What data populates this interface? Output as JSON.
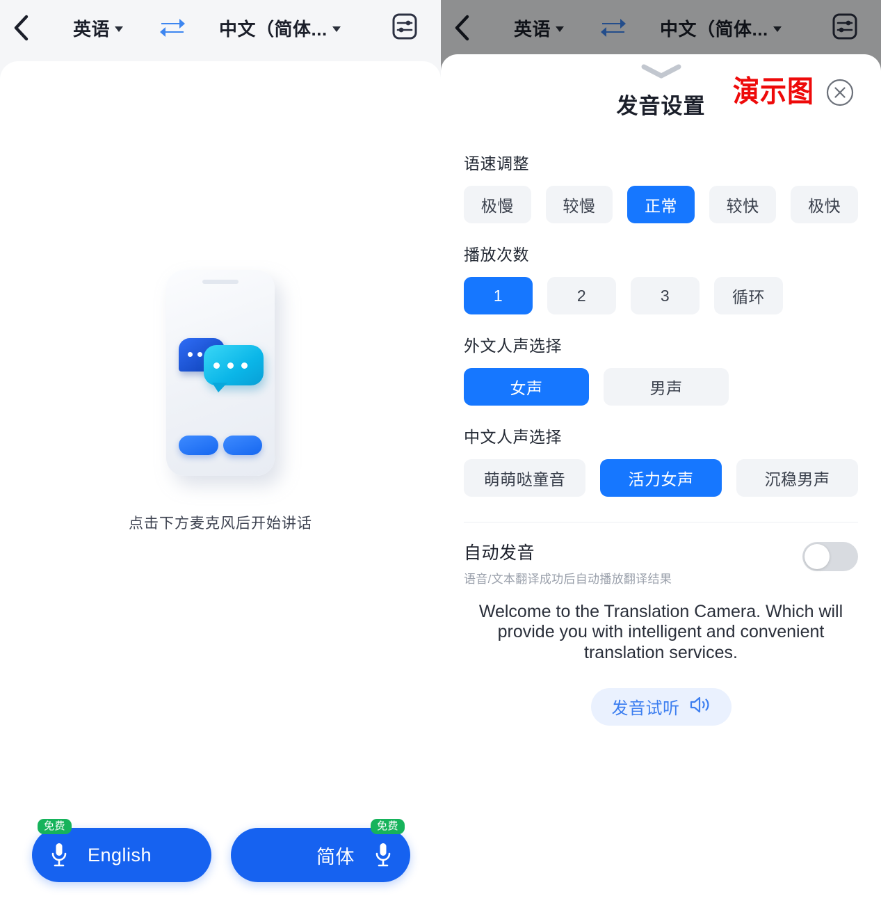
{
  "header": {
    "back_icon": "back-chevron-icon",
    "source_language": "英语",
    "swap_icon": "swap-arrows-icon",
    "target_language": "中文（简体...",
    "settings_icon": "sliders-settings-icon"
  },
  "left_screen": {
    "illustration_icon": "phone-chat-bubbles-illustration",
    "hint": "点击下方麦克风后开始讲话",
    "mic_buttons": [
      {
        "label": "English",
        "badge": "免费",
        "icon": "microphone-icon"
      },
      {
        "label": "简体",
        "badge": "免费",
        "icon": "microphone-icon"
      }
    ]
  },
  "right_screen": {
    "watermark": "演示图",
    "watermark_color": "#ee0a0a",
    "sheet": {
      "handle_icon": "chevron-down-handle-icon",
      "title": "发音设置",
      "close_icon": "close-circle-icon",
      "accent_color": "#1677ff",
      "groups": [
        {
          "title": "语速调整",
          "options": [
            "极慢",
            "较慢",
            "正常",
            "较快",
            "极快"
          ],
          "selected": "正常"
        },
        {
          "title": "播放次数",
          "options": [
            "1",
            "2",
            "3",
            "循环"
          ],
          "selected": "1"
        },
        {
          "title": "外文人声选择",
          "options": [
            "女声",
            "男声"
          ],
          "selected": "女声"
        },
        {
          "title": "中文人声选择",
          "options": [
            "萌萌哒童音",
            "活力女声",
            "沉稳男声"
          ],
          "selected": "活力女声"
        }
      ],
      "auto_speak": {
        "title": "自动发音",
        "subtitle": "语音/文本翻译成功后自动播放翻译结果",
        "enabled": false
      },
      "sample_text": "Welcome to the Translation Camera. Which will provide you with intelligent and convenient translation services.",
      "preview_button": {
        "label": "发音试听",
        "icon": "speaker-volume-icon"
      }
    }
  }
}
